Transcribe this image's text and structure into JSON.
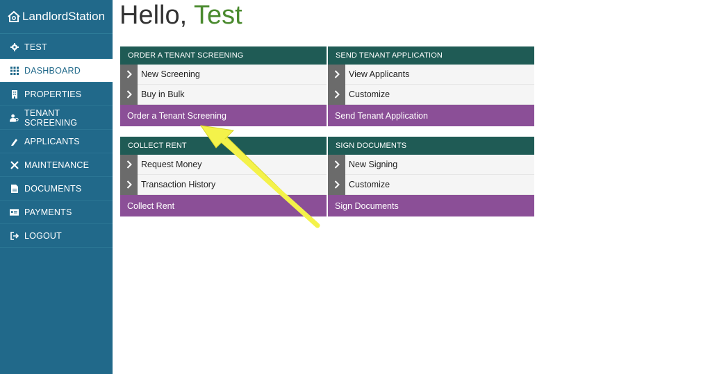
{
  "app": {
    "brand": "LandlordStation"
  },
  "greeting": {
    "prefix": "Hello, ",
    "name": "Test"
  },
  "sidebar": {
    "items": [
      {
        "label": "TEST",
        "icon": "gear-icon"
      },
      {
        "label": "DASHBOARD",
        "icon": "grid-icon",
        "active": true
      },
      {
        "label": "PROPERTIES",
        "icon": "building-icon"
      },
      {
        "label": "TENANT SCREENING",
        "icon": "user-search-icon"
      },
      {
        "label": "APPLICANTS",
        "icon": "pen-icon"
      },
      {
        "label": "MAINTENANCE",
        "icon": "tools-icon"
      },
      {
        "label": "DOCUMENTS",
        "icon": "document-icon"
      },
      {
        "label": "PAYMENTS",
        "icon": "card-icon"
      },
      {
        "label": "LOGOUT",
        "icon": "logout-icon"
      }
    ]
  },
  "cards": {
    "screening": {
      "header": "ORDER A TENANT SCREENING",
      "rows": [
        "New Screening",
        "Buy in Bulk"
      ],
      "footer": "Order a Tenant Screening"
    },
    "application": {
      "header": "SEND TENANT APPLICATION",
      "rows": [
        "View Applicants",
        "Customize"
      ],
      "footer": "Send Tenant Application"
    },
    "rent": {
      "header": "COLLECT RENT",
      "rows": [
        "Request Money",
        "Transaction History"
      ],
      "footer": "Collect Rent"
    },
    "documents": {
      "header": "SIGN DOCUMENTS",
      "rows": [
        "New Signing",
        "Customize"
      ],
      "footer": "Sign Documents"
    }
  },
  "colors": {
    "sidebar": "#21698a",
    "card_header": "#1f5b55",
    "card_footer": "#8b4f97",
    "greeting_name": "#4a8a2e",
    "annotation_arrow": "#f4f24a"
  }
}
